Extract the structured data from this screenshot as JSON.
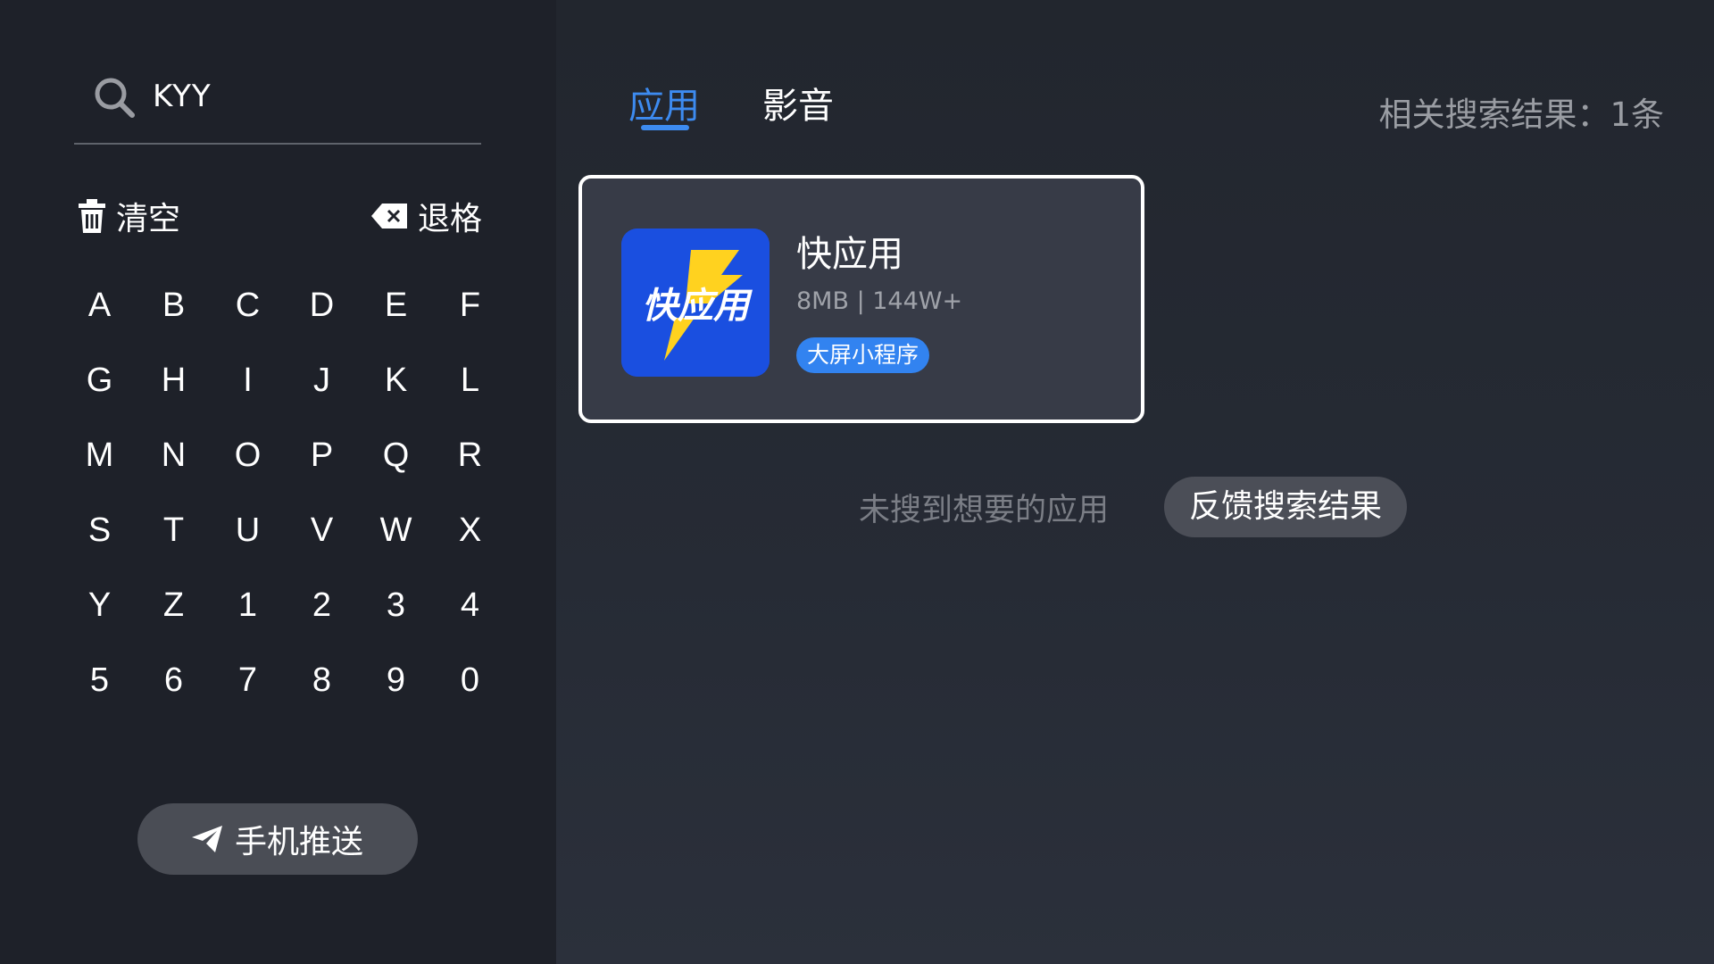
{
  "search": {
    "query": "KYY",
    "icon": "search-icon"
  },
  "actions": {
    "clear_label": "清空",
    "backspace_label": "退格"
  },
  "keyboard": {
    "keys": [
      "A",
      "B",
      "C",
      "D",
      "E",
      "F",
      "G",
      "H",
      "I",
      "J",
      "K",
      "L",
      "M",
      "N",
      "O",
      "P",
      "Q",
      "R",
      "S",
      "T",
      "U",
      "V",
      "W",
      "X",
      "Y",
      "Z",
      "1",
      "2",
      "3",
      "4",
      "5",
      "6",
      "7",
      "8",
      "9",
      "0"
    ]
  },
  "push": {
    "label": "手机推送",
    "icon": "send-icon"
  },
  "tabs": [
    {
      "label": "应用",
      "active": true
    },
    {
      "label": "影音",
      "active": false
    }
  ],
  "results": {
    "count_text": "相关搜索结果：1条",
    "apps": [
      {
        "name": "快应用",
        "meta": "8MB | 144W+",
        "badge": "大屏小程序",
        "icon_text": "快应用"
      }
    ]
  },
  "feedback": {
    "hint": "未搜到想要的应用",
    "button_label": "反馈搜索结果"
  },
  "colors": {
    "accent": "#3d8bf0",
    "card_border": "#ffffff",
    "badge": "#3283f0",
    "app_icon_bg": "#1a4fe0",
    "lightning": "#ffd21f"
  }
}
